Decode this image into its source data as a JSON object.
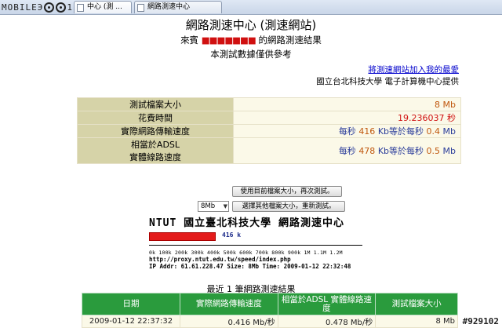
{
  "browser": {
    "logo_left": "MOBIL",
    "logo_mid": "ЕЭ",
    "logo_right": "1",
    "tabs": [
      {
        "label": "中心 (測 ...",
        "active": true
      },
      {
        "label": "網路測速中心",
        "active": false
      }
    ]
  },
  "header": {
    "title": "網路測速中心 (測速網站)",
    "visit_prefix": "來賓",
    "visit_masked": "■■■■■■■",
    "visit_suffix": "的網路測速結果",
    "reference_note": "本測試數據僅供參考",
    "add_favorite_link": "將測速網站加入我的最愛",
    "provider": "國立台北科技大學 電子計算機中心提供"
  },
  "results": {
    "file_size": {
      "label": "測試檔案大小",
      "value": "8",
      "unit": "Mb"
    },
    "elapsed": {
      "label": "花費時間",
      "value": "19.236037",
      "unit": "秒"
    },
    "transfer": {
      "label": "實際網路傳輸速度",
      "prefix": "每秒",
      "kb": "416",
      "kb_unit": "Kb",
      "equal": "等於",
      "prefix2": "每秒",
      "mb": "0.4",
      "mb_unit": "Mb"
    },
    "adsl": {
      "label_line1": "相當於ADSL",
      "label_line2": "實體線路速度",
      "prefix": "每秒",
      "kb": "478",
      "kb_unit": "Kb",
      "equal": "等於",
      "prefix2": "每秒",
      "mb": "0.5",
      "mb_unit": "Mb"
    }
  },
  "controls": {
    "retest_button": "使用目前檔案大小，再次測試。",
    "size_select_value": "8Mb",
    "reselect_button": "選擇其他檔案大小，重新測試。"
  },
  "graphic": {
    "heading": "NTUT  國立臺北科技大學 網路測速中心",
    "speed_label": "416 k",
    "speed_fraction": 0.3467,
    "ticks": "0k   100k 200k 300k 400k 500k 600k 700k 800k 900k 1M   1.1M 1.2M",
    "url_line": "http://proxy.ntut.edu.tw/speed/index.php",
    "ip_line": "IP Addr: 61.61.228.47 Size: 8Mb Time: 2009-01-12 22:32:48"
  },
  "recent": {
    "title": "最近 1 筆網路測速結果",
    "headers": [
      "日期",
      "實際網路傳輸速度",
      "相當於ADSL 實體線路速度",
      "測試檔案大小"
    ],
    "rows": [
      [
        "2009-01-12 22:37:32",
        "0.416 Mb/秒",
        "0.478 Mb/秒",
        "8 Mb"
      ]
    ]
  },
  "watermark": "#929102",
  "colors": {
    "label_bg": "#d6d3a8",
    "value_bg": "#fbf9e8",
    "header_green": "#2a9b3d",
    "bar_red": "#e41b1b"
  }
}
